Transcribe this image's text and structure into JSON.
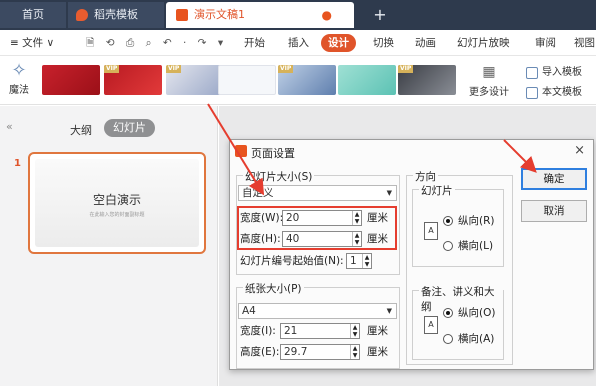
{
  "tabs": {
    "home": "首页",
    "template": "稻壳模板",
    "document": "演示文稿1",
    "new_tab": "+"
  },
  "menu": {
    "file": "≡ 文件 ∨",
    "quick_access": "🗎 ⟲ ⎙ ⌕ ↶ · ↷ ▾",
    "items": {
      "start": "开始",
      "insert": "插入",
      "design": "设计",
      "switch": "切换",
      "animation": "动画",
      "slideshow": "幻灯片放映",
      "review": "审阅",
      "view": "视图"
    }
  },
  "ribbon": {
    "magic": "魔法",
    "vip_badge": "VIP",
    "more_design": "更多设计",
    "import_template": "导入模板",
    "text_template": "本文模板"
  },
  "left_panel": {
    "outline_tab": "大纲",
    "slides_tab": "幻灯片",
    "slide_number": "1",
    "slide_title": "空白演示",
    "slide_subtitle": "在此输入您的封面副标题"
  },
  "dialog": {
    "title": "页面设置",
    "close": "×",
    "slide_size_group": "幻灯片大小(S)",
    "slide_size_value": "自定义",
    "width_label": "宽度(W):",
    "width_value": "20",
    "width_unit": "厘米",
    "height_label": "高度(H):",
    "height_value": "40",
    "height_unit": "厘米",
    "start_number_label": "幻灯片编号起始值(N):",
    "start_number_value": "1",
    "paper_group": "纸张大小(P)",
    "paper_value": "A4",
    "paper_width_label": "宽度(I):",
    "paper_width_value": "21",
    "paper_width_unit": "厘米",
    "paper_height_label": "高度(E):",
    "paper_height_value": "29.7",
    "paper_height_unit": "厘米",
    "orientation_group": "方向",
    "slides_subgroup": "幻灯片",
    "slides_portrait": "纵向(R)",
    "slides_landscape": "横向(L)",
    "notes_subgroup": "备注、讲义和大纲",
    "notes_portrait": "纵向(O)",
    "notes_landscape": "横向(A)",
    "ok_button": "确定",
    "cancel_button": "取消"
  },
  "colors": {
    "accent": "#e0542a",
    "highlight": "#e53d2f",
    "tabbar": "#2e3a4d"
  }
}
